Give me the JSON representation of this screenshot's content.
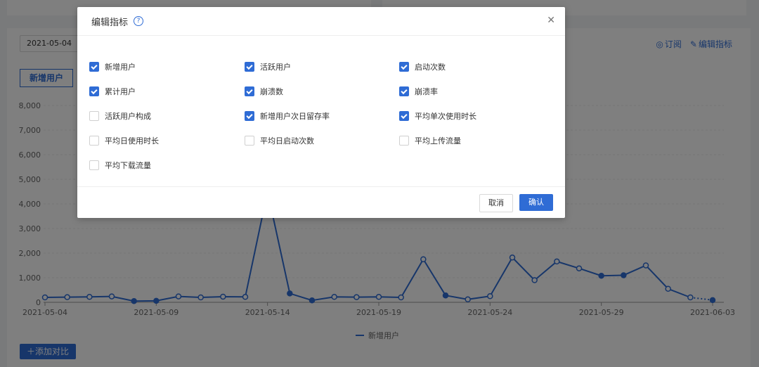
{
  "toolbar": {
    "date": "2021-05-04",
    "subscribe_label": "订阅",
    "edit_metrics_label": "编辑指标",
    "metric_tab": "新增用户",
    "add_compare_label": "添加对比"
  },
  "modal": {
    "title": "编辑指标",
    "options": [
      {
        "label": "新增用户",
        "checked": true
      },
      {
        "label": "活跃用户",
        "checked": true
      },
      {
        "label": "启动次数",
        "checked": true
      },
      {
        "label": "累计用户",
        "checked": true
      },
      {
        "label": "崩溃数",
        "checked": true
      },
      {
        "label": "崩溃率",
        "checked": true
      },
      {
        "label": "活跃用户构成",
        "checked": false
      },
      {
        "label": "新增用户次日留存率",
        "checked": true
      },
      {
        "label": "平均单次使用时长",
        "checked": true
      },
      {
        "label": "平均日使用时长",
        "checked": false
      },
      {
        "label": "平均日启动次数",
        "checked": false
      },
      {
        "label": "平均上传流量",
        "checked": false
      },
      {
        "label": "平均下载流量",
        "checked": false
      }
    ],
    "cancel_label": "取消",
    "confirm_label": "确认"
  },
  "colors": {
    "accent": "#2f6cd5",
    "series": "#2f6cd5"
  },
  "chart_data": {
    "type": "line",
    "x": [
      "2021-05-04",
      "2021-05-05",
      "2021-05-06",
      "2021-05-07",
      "2021-05-08",
      "2021-05-09",
      "2021-05-10",
      "2021-05-11",
      "2021-05-12",
      "2021-05-13",
      "2021-05-14",
      "2021-05-15",
      "2021-05-16",
      "2021-05-17",
      "2021-05-18",
      "2021-05-19",
      "2021-05-20",
      "2021-05-21",
      "2021-05-22",
      "2021-05-23",
      "2021-05-24",
      "2021-05-25",
      "2021-05-26",
      "2021-05-27",
      "2021-05-28",
      "2021-05-29",
      "2021-05-30",
      "2021-05-31",
      "2021-06-01",
      "2021-06-02",
      "2021-06-03"
    ],
    "x_tick_labels": [
      "2021-05-04",
      "2021-05-09",
      "2021-05-14",
      "2021-05-19",
      "2021-05-24",
      "2021-05-29",
      "2021-06-03"
    ],
    "series": [
      {
        "name": "新增用户",
        "values": [
          200,
          210,
          220,
          240,
          50,
          60,
          240,
          200,
          230,
          220,
          4500,
          360,
          80,
          220,
          210,
          220,
          200,
          1750,
          280,
          120,
          250,
          1820,
          900,
          1660,
          1380,
          1080,
          1100,
          1500,
          550,
          200,
          90
        ]
      }
    ],
    "yticks": [
      0,
      1000,
      2000,
      3000,
      4000,
      5000,
      6000,
      7000,
      8000
    ],
    "ytick_labels": [
      "0",
      "1,000",
      "2,000",
      "3,000",
      "4,000",
      "5,000",
      "6,000",
      "7,000",
      "8,000"
    ],
    "ylim": [
      0,
      8000
    ],
    "grid": true,
    "legend": "bottom-center"
  }
}
